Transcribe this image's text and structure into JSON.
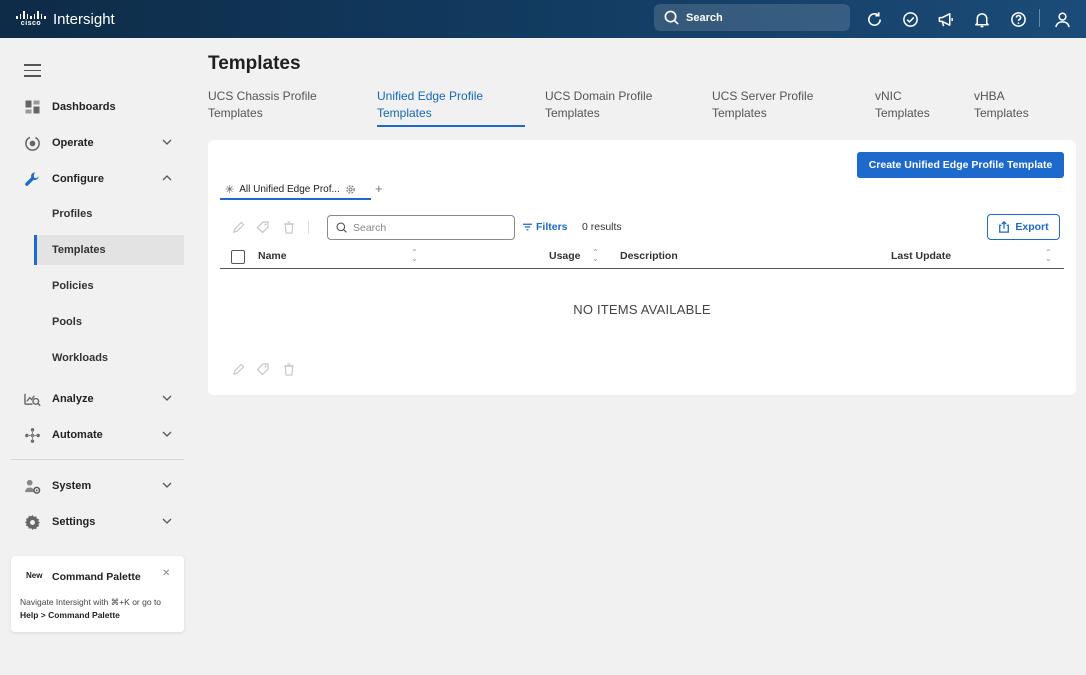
{
  "app": {
    "brand_logo_text": "cisco",
    "brand_name": "Intersight",
    "search_label": "Search"
  },
  "topbar_icons": [
    "refresh-icon",
    "tasks-check-icon",
    "announcement-megaphone-icon",
    "notifications-bell-icon",
    "help-icon",
    "user-icon"
  ],
  "sidebar": {
    "items": [
      {
        "label": "Dashboards",
        "icon": "dashboard-icon"
      },
      {
        "label": "Operate",
        "icon": "operate-icon"
      },
      {
        "label": "Configure",
        "icon": "configure-wrench-icon"
      },
      {
        "label": "Analyze",
        "icon": "analyze-icon"
      },
      {
        "label": "Automate",
        "icon": "automate-icon"
      },
      {
        "label": "System",
        "icon": "system-icon"
      },
      {
        "label": "Settings",
        "icon": "settings-gear-icon"
      }
    ],
    "configure_sub": [
      {
        "label": "Profiles"
      },
      {
        "label": "Templates",
        "active": true
      },
      {
        "label": "Policies"
      },
      {
        "label": "Pools"
      },
      {
        "label": "Workloads"
      }
    ]
  },
  "command_palette": {
    "badge": "New",
    "title": "Command Palette",
    "body_prefix": "Navigate Intersight with ⌘+K or go to ",
    "body_path": "Help > Command Palette"
  },
  "main": {
    "title": "Templates",
    "tabs": [
      {
        "line1": "UCS Chassis Profile",
        "line2": "Templates"
      },
      {
        "line1": "Unified Edge Profile",
        "line2": "Templates",
        "active": true
      },
      {
        "line1": "UCS Domain Profile",
        "line2": "Templates"
      },
      {
        "line1": "UCS Server Profile",
        "line2": "Templates"
      },
      {
        "line1": "vNIC",
        "line2": "Templates"
      },
      {
        "line1": "vHBA",
        "line2": "Templates"
      }
    ],
    "create_button": "Create Unified Edge Profile Template",
    "view_tab": "All Unified Edge Prof...",
    "add_view": "+",
    "search_placeholder": "Search",
    "filters_label": "Filters",
    "results": "0 results",
    "export_label": "Export",
    "columns": [
      "Name",
      "Usage",
      "Description",
      "Last Update"
    ],
    "empty_text": "NO ITEMS AVAILABLE"
  },
  "colors": {
    "accent": "#1d69cc",
    "topbar_start": "#0e2b47",
    "topbar_end": "#1b4b78",
    "active_tab_text": "#1568b8"
  }
}
